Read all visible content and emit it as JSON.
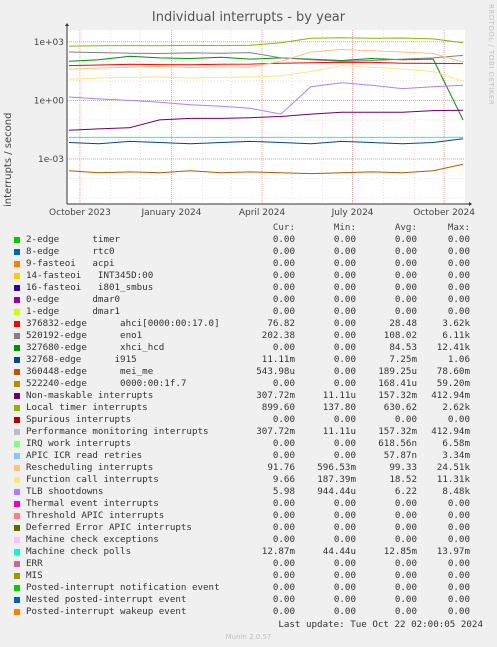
{
  "title": "Individual interrupts - by year",
  "ylabel": "interrupts / second",
  "watermark": "RRDTOOL / TOBI OETIKER",
  "last_update": "Last update: Tue Oct 22 02:00:05 2024",
  "footer": "Munin 2.0.57",
  "legend_headers": {
    "cur": "Cur:",
    "min": "Min:",
    "avg": "Avg:",
    "max": "Max:"
  },
  "legend": [
    {
      "name": "2-edge      timer",
      "color": "#00cc00",
      "cur": "0.00",
      "min": "0.00",
      "avg": "0.00",
      "max": "0.00"
    },
    {
      "name": "8-edge      rtc0",
      "color": "#0066b3",
      "cur": "0.00",
      "min": "0.00",
      "avg": "0.00",
      "max": "0.00"
    },
    {
      "name": "9-fasteoi   acpi",
      "color": "#ff8000",
      "cur": "0.00",
      "min": "0.00",
      "avg": "0.00",
      "max": "0.00"
    },
    {
      "name": "14-fasteoi   INT345D:00",
      "color": "#ffcc00",
      "cur": "0.00",
      "min": "0.00",
      "avg": "0.00",
      "max": "0.00"
    },
    {
      "name": "16-fasteoi   i801_smbus",
      "color": "#330099",
      "cur": "0.00",
      "min": "0.00",
      "avg": "0.00",
      "max": "0.00"
    },
    {
      "name": "0-edge      dmar0",
      "color": "#990099",
      "cur": "0.00",
      "min": "0.00",
      "avg": "0.00",
      "max": "0.00"
    },
    {
      "name": "1-edge      dmar1",
      "color": "#ccff00",
      "cur": "0.00",
      "min": "0.00",
      "avg": "0.00",
      "max": "0.00"
    },
    {
      "name": "376832-edge      ahci[0000:00:17.0]",
      "color": "#ff0000",
      "cur": "76.82",
      "min": "0.00",
      "avg": "28.48",
      "max": "3.62k"
    },
    {
      "name": "520192-edge      eno1",
      "color": "#808080",
      "cur": "202.38",
      "min": "0.00",
      "avg": "108.02",
      "max": "6.11k"
    },
    {
      "name": "327680-edge      xhci_hcd",
      "color": "#008f00",
      "cur": "0.00",
      "min": "0.00",
      "avg": "84.53",
      "max": "12.41k"
    },
    {
      "name": "32768-edge      i915",
      "color": "#00487d",
      "cur": "11.11m",
      "min": "0.00",
      "avg": "7.25m",
      "max": "1.06"
    },
    {
      "name": "360448-edge      mei_me",
      "color": "#b35a00",
      "cur": "543.98u",
      "min": "0.00",
      "avg": "189.25u",
      "max": "78.60m"
    },
    {
      "name": "522240-edge      0000:00:1f.7",
      "color": "#b38f00",
      "cur": "0.00",
      "min": "0.00",
      "avg": "168.41u",
      "max": "59.20m"
    },
    {
      "name": "Non-maskable interrupts",
      "color": "#6b006b",
      "cur": "307.72m",
      "min": "11.11u",
      "avg": "157.32m",
      "max": "412.94m"
    },
    {
      "name": "Local timer interrupts",
      "color": "#8fb300",
      "cur": "899.60",
      "min": "137.80",
      "avg": "630.62",
      "max": "2.62k"
    },
    {
      "name": "Spurious interrupts",
      "color": "#b30000",
      "cur": "0.00",
      "min": "0.00",
      "avg": "0.00",
      "max": "0.00"
    },
    {
      "name": "Performance monitoring interrupts",
      "color": "#bebebe",
      "cur": "307.72m",
      "min": "11.11u",
      "avg": "157.32m",
      "max": "412.94m"
    },
    {
      "name": "IRQ work interrupts",
      "color": "#80ff80",
      "cur": "0.00",
      "min": "0.00",
      "avg": "618.56n",
      "max": "6.58m"
    },
    {
      "name": "APIC ICR read retries",
      "color": "#80c9ff",
      "cur": "0.00",
      "min": "0.00",
      "avg": "57.87n",
      "max": "3.34m"
    },
    {
      "name": "Rescheduling interrupts",
      "color": "#ffc080",
      "cur": "91.76",
      "min": "596.53m",
      "avg": "99.33",
      "max": "24.51k"
    },
    {
      "name": "Function call interrupts",
      "color": "#ffe680",
      "cur": "9.66",
      "min": "187.39m",
      "avg": "18.52",
      "max": "11.31k"
    },
    {
      "name": "TLB shootdowns",
      "color": "#aa80ff",
      "cur": "5.98",
      "min": "944.44u",
      "avg": "6.22",
      "max": "8.48k"
    },
    {
      "name": "Thermal event interrupts",
      "color": "#ee00cc",
      "cur": "0.00",
      "min": "0.00",
      "avg": "0.00",
      "max": "0.00"
    },
    {
      "name": "Threshold APIC interrupts",
      "color": "#ff8080",
      "cur": "0.00",
      "min": "0.00",
      "avg": "0.00",
      "max": "0.00"
    },
    {
      "name": "Deferred Error APIC interrupts",
      "color": "#666600",
      "cur": "0.00",
      "min": "0.00",
      "avg": "0.00",
      "max": "0.00"
    },
    {
      "name": "Machine check exceptions",
      "color": "#ffbfff",
      "cur": "0.00",
      "min": "0.00",
      "avg": "0.00",
      "max": "0.00"
    },
    {
      "name": "Machine check polls",
      "color": "#00ffcc",
      "cur": "12.87m",
      "min": "44.44u",
      "avg": "12.85m",
      "max": "13.97m"
    },
    {
      "name": "ERR",
      "color": "#cc6699",
      "cur": "0.00",
      "min": "0.00",
      "avg": "0.00",
      "max": "0.00"
    },
    {
      "name": "MIS",
      "color": "#999900",
      "cur": "0.00",
      "min": "0.00",
      "avg": "0.00",
      "max": "0.00"
    },
    {
      "name": "Posted-interrupt notification event",
      "color": "#00cc00",
      "cur": "0.00",
      "min": "0.00",
      "avg": "0.00",
      "max": "0.00"
    },
    {
      "name": "Nested posted-interrupt event",
      "color": "#0066b3",
      "cur": "0.00",
      "min": "0.00",
      "avg": "0.00",
      "max": "0.00"
    },
    {
      "name": "Posted-interrupt wakeup event",
      "color": "#ff8000",
      "cur": "0.00",
      "min": "0.00",
      "avg": "0.00",
      "max": "0.00"
    }
  ],
  "chart_data": {
    "type": "line",
    "title": "Individual interrupts - by year",
    "ylabel": "interrupts / second",
    "yscale": "log",
    "ylim": [
      5e-06,
      4000
    ],
    "y_ticks": [
      {
        "value": 0.001,
        "label": "1e-03"
      },
      {
        "value": 1,
        "label": "1e+00"
      },
      {
        "value": 1000,
        "label": "1e+03"
      }
    ],
    "x_ticks": [
      {
        "value": "2023-10-01",
        "label": "October 2023"
      },
      {
        "value": "2024-01-01",
        "label": "January 2024"
      },
      {
        "value": "2024-04-01",
        "label": "April 2024"
      },
      {
        "value": "2024-07-01",
        "label": "July 2024"
      },
      {
        "value": "2024-10-01",
        "label": "October 2024"
      }
    ],
    "xlim": [
      "2023-09-18",
      "2024-10-22"
    ],
    "grid": true,
    "series": [
      {
        "name": "Local timer interrupts",
        "color": "#8fb300",
        "x": [
          "2023-09-20",
          "2023-10-20",
          "2023-11-20",
          "2023-12-20",
          "2024-01-20",
          "2024-02-20",
          "2024-03-20",
          "2024-04-20",
          "2024-05-20",
          "2024-06-20",
          "2024-07-20",
          "2024-08-20",
          "2024-09-20",
          "2024-10-20"
        ],
        "y": [
          600,
          620,
          640,
          630,
          650,
          640,
          660,
          900,
          1500,
          1600,
          1500,
          1550,
          1400,
          900
        ]
      },
      {
        "name": "xhci_hcd",
        "color": "#008f00",
        "x": [
          "2023-09-20",
          "2023-10-20",
          "2023-11-20",
          "2023-12-20",
          "2024-01-20",
          "2024-02-20",
          "2024-03-20",
          "2024-04-20",
          "2024-05-20",
          "2024-06-20",
          "2024-07-20",
          "2024-08-20",
          "2024-09-20",
          "2024-10-20"
        ],
        "y": [
          100,
          120,
          180,
          150,
          140,
          160,
          130,
          150,
          130,
          110,
          140,
          120,
          130,
          0.1
        ]
      },
      {
        "name": "eno1",
        "color": "#808080",
        "x": [
          "2023-09-20",
          "2023-10-20",
          "2023-11-20",
          "2023-12-20",
          "2024-01-20",
          "2024-02-20",
          "2024-03-20",
          "2024-04-20",
          "2024-05-20",
          "2024-06-20",
          "2024-07-20",
          "2024-08-20",
          "2024-09-20",
          "2024-10-20"
        ],
        "y": [
          300,
          280,
          260,
          250,
          270,
          260,
          280,
          150,
          120,
          100,
          110,
          130,
          150,
          200
        ]
      },
      {
        "name": "ahci[0000:00:17.0]",
        "color": "#ff0000",
        "x": [
          "2023-09-20",
          "2023-10-20",
          "2023-11-20",
          "2023-12-20",
          "2024-01-20",
          "2024-02-20",
          "2024-03-20",
          "2024-04-20",
          "2024-05-20",
          "2024-06-20",
          "2024-07-20",
          "2024-08-20",
          "2024-09-20",
          "2024-10-20"
        ],
        "y": [
          60,
          65,
          70,
          68,
          66,
          70,
          72,
          80,
          85,
          90,
          88,
          80,
          78,
          76
        ]
      },
      {
        "name": "Rescheduling interrupts",
        "color": "#ffc080",
        "x": [
          "2023-09-20",
          "2023-10-20",
          "2023-11-20",
          "2023-12-20",
          "2024-01-20",
          "2024-02-20",
          "2024-03-20",
          "2024-04-20",
          "2024-05-20",
          "2024-06-20",
          "2024-07-20",
          "2024-08-20",
          "2024-09-20",
          "2024-10-20"
        ],
        "y": [
          40,
          45,
          50,
          55,
          48,
          52,
          50,
          100,
          300,
          400,
          350,
          300,
          250,
          92
        ]
      },
      {
        "name": "Function call interrupts",
        "color": "#ffe680",
        "x": [
          "2023-09-20",
          "2023-10-20",
          "2023-11-20",
          "2023-12-20",
          "2024-01-20",
          "2024-02-20",
          "2024-03-20",
          "2024-04-20",
          "2024-05-20",
          "2024-06-20",
          "2024-07-20",
          "2024-08-20",
          "2024-09-20",
          "2024-10-20"
        ],
        "y": [
          12,
          14,
          15,
          16,
          14,
          15,
          16,
          18,
          30,
          60,
          50,
          40,
          30,
          9.7
        ]
      },
      {
        "name": "TLB shootdowns",
        "color": "#aa80ff",
        "x": [
          "2023-09-20",
          "2023-10-20",
          "2023-11-20",
          "2023-12-20",
          "2024-01-20",
          "2024-02-20",
          "2024-03-20",
          "2024-04-20",
          "2024-05-20",
          "2024-06-20",
          "2024-07-20",
          "2024-08-20",
          "2024-09-20",
          "2024-10-20"
        ],
        "y": [
          1.5,
          1.2,
          1.0,
          0.8,
          0.6,
          0.5,
          0.4,
          0.2,
          5,
          8,
          6,
          4,
          5,
          6
        ]
      },
      {
        "name": "Non-maskable interrupts",
        "color": "#6b006b",
        "x": [
          "2023-09-20",
          "2023-10-20",
          "2023-11-20",
          "2023-12-20",
          "2024-01-20",
          "2024-02-20",
          "2024-03-20",
          "2024-04-20",
          "2024-05-20",
          "2024-06-20",
          "2024-07-20",
          "2024-08-20",
          "2024-09-20",
          "2024-10-20"
        ],
        "y": [
          0.03,
          0.035,
          0.04,
          0.1,
          0.12,
          0.12,
          0.13,
          0.15,
          0.2,
          0.25,
          0.25,
          0.25,
          0.3,
          0.31
        ]
      },
      {
        "name": "Machine check polls",
        "color": "#00ffcc",
        "x": [
          "2023-09-20",
          "2023-10-20",
          "2023-11-20",
          "2023-12-20",
          "2024-01-20",
          "2024-02-20",
          "2024-03-20",
          "2024-04-20",
          "2024-05-20",
          "2024-06-20",
          "2024-07-20",
          "2024-08-20",
          "2024-09-20",
          "2024-10-20"
        ],
        "y": [
          0.0128,
          0.0128,
          0.0128,
          0.0128,
          0.0128,
          0.0128,
          0.0128,
          0.0128,
          0.0128,
          0.0128,
          0.0128,
          0.0128,
          0.0128,
          0.0129
        ]
      },
      {
        "name": "i915",
        "color": "#00487d",
        "x": [
          "2023-09-20",
          "2023-10-20",
          "2023-11-20",
          "2023-12-20",
          "2024-01-20",
          "2024-02-20",
          "2024-03-20",
          "2024-04-20",
          "2024-05-20",
          "2024-06-20",
          "2024-07-20",
          "2024-08-20",
          "2024-09-20",
          "2024-10-20"
        ],
        "y": [
          0.007,
          0.006,
          0.008,
          0.007,
          0.006,
          0.007,
          0.008,
          0.007,
          0.006,
          0.008,
          0.007,
          0.006,
          0.007,
          0.011
        ]
      },
      {
        "name": "mei_me",
        "color": "#b35a00",
        "x": [
          "2023-09-20",
          "2023-10-20",
          "2023-11-20",
          "2023-12-20",
          "2024-01-20",
          "2024-02-20",
          "2024-03-20",
          "2024-04-20",
          "2024-05-20",
          "2024-06-20",
          "2024-07-20",
          "2024-08-20",
          "2024-09-20",
          "2024-10-20"
        ],
        "y": [
          0.00025,
          0.0002,
          0.00022,
          0.0002,
          0.00025,
          0.0002,
          0.00022,
          0.0002,
          0.00018,
          0.0002,
          0.00022,
          0.0002,
          0.00025,
          0.00054
        ]
      }
    ]
  }
}
